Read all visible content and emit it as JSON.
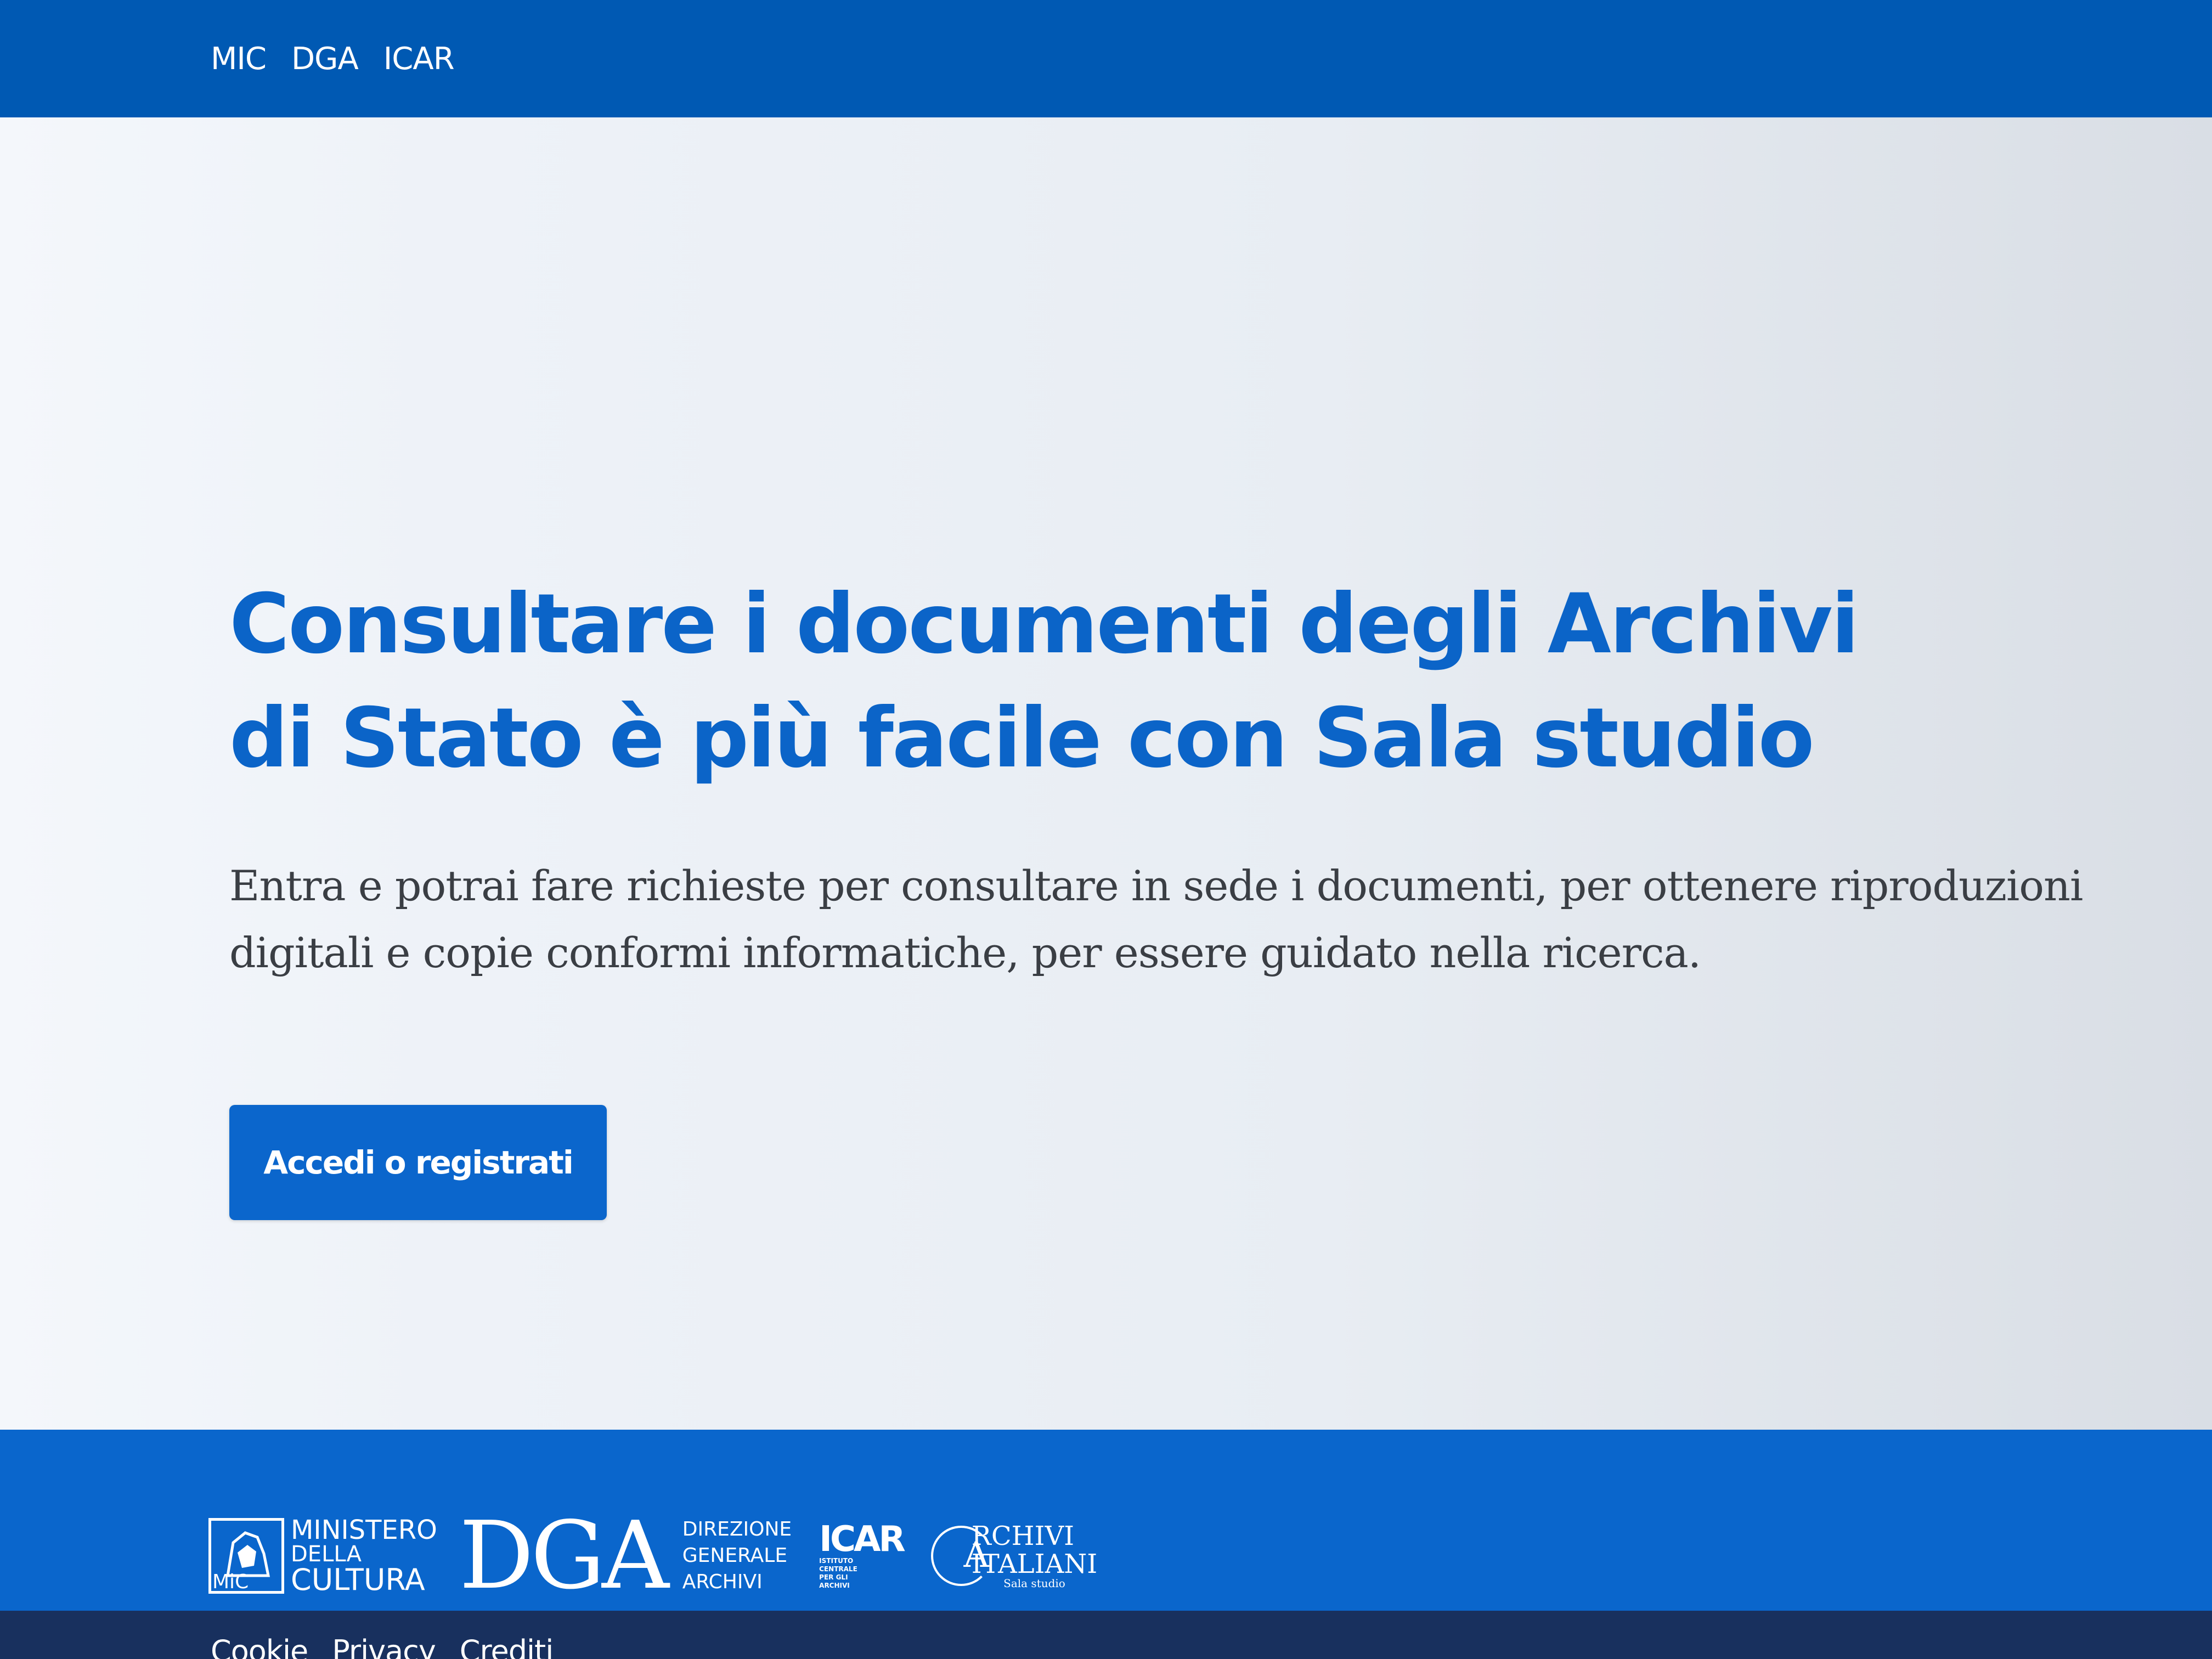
{
  "header": {
    "nav": [
      "MIC",
      "DGA",
      "ICAR"
    ]
  },
  "hero": {
    "title": "Consultare i documenti degli Archivi di Stato è più facile con Sala studio",
    "text": "Entra e potrai fare richieste per consultare in sede i documenti, per ottenere riproduzioni digitali e copie conformi informatiche, per essere guidato nella ricerca.",
    "button_label": "Accedi o registrati"
  },
  "footer": {
    "logos": {
      "mic": {
        "mark": "MiC",
        "lines": [
          "MINISTERO",
          "DELLA",
          "CULTURA"
        ]
      },
      "dga": {
        "mark": "DGA",
        "lines": [
          "DIREZIONE",
          "GENERALE",
          "ARCHIVI"
        ]
      },
      "icar": {
        "mark": "ICAR",
        "lines": [
          "ISTITUTO",
          "CENTRALE",
          "PER GLI",
          "ARCHIVI"
        ]
      },
      "archivi": {
        "mark": "A",
        "lines": [
          "RCHIVI",
          "ITALIANI",
          "Sala studio"
        ]
      }
    }
  },
  "bottom_bar": {
    "links": [
      "Cookie",
      "Privacy",
      "Crediti"
    ]
  },
  "colors": {
    "header_blue": "#0059b3",
    "title_blue": "#0b64c8",
    "button_blue": "#0b66cc",
    "footer_blue": "#0a66cc",
    "bottom_bar_navy": "#18305e"
  }
}
